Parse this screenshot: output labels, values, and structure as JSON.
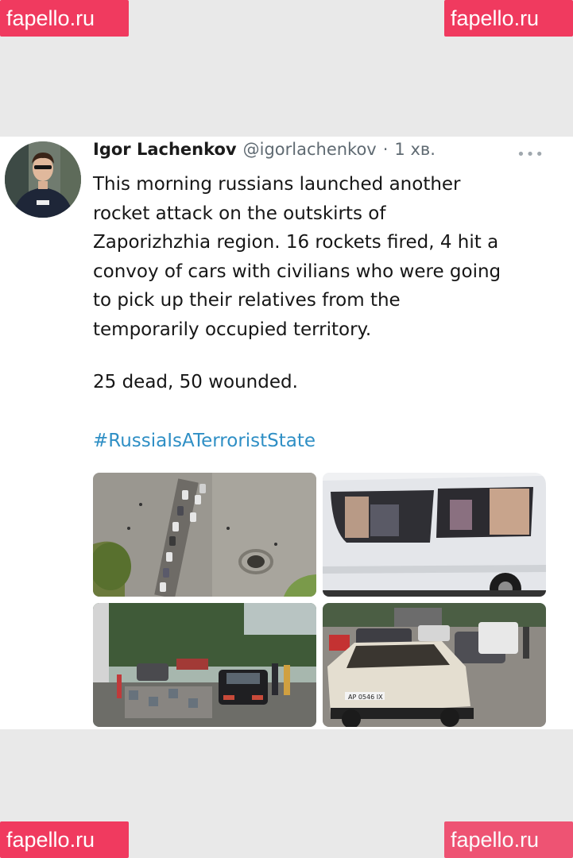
{
  "watermarks": {
    "top_left": "fapello.ru",
    "top_right": "fapello.ru",
    "bottom_left": "fapello.ru",
    "bottom_right": "fapello.ru"
  },
  "tweet": {
    "author_name": "Igor Lachenkov",
    "handle": "@igorlachenkov",
    "separator": "·",
    "time": "1 хв.",
    "more_icon": "more-horizontal-icon",
    "text": "This morning russians launched another\nrocket attack on the outskirts of\nZaporizhzhia region. 16 rockets fired, 4 hit a\nconvoy of cars with civilians who were going\nto pick up their relatives from the\ntemporarily occupied territory.",
    "stats": "25 dead, 50 wounded.",
    "hashtag": "#RussiaIsATerroristState",
    "link_color": "#2f8fc5"
  },
  "photos": {
    "photo1": {
      "plate": ""
    },
    "photo4": {
      "plate": "AP 0546 IX"
    }
  }
}
